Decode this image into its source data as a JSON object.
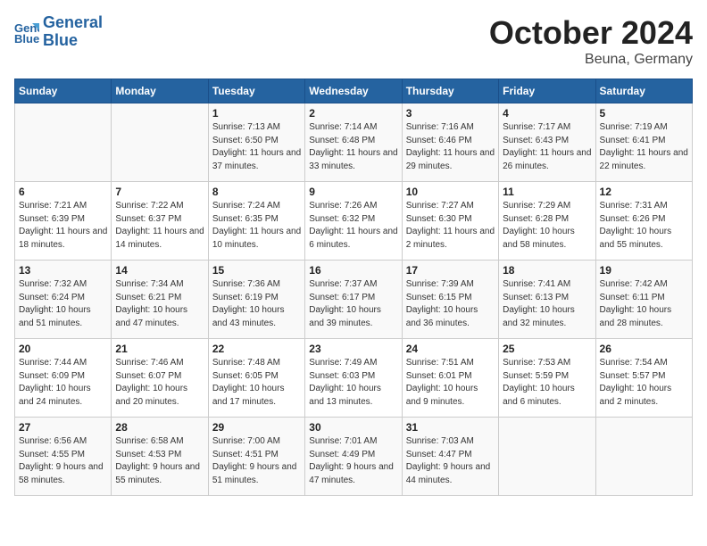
{
  "header": {
    "logo": {
      "line1": "General",
      "line2": "Blue"
    },
    "month": "October 2024",
    "location": "Beuna, Germany"
  },
  "weekdays": [
    "Sunday",
    "Monday",
    "Tuesday",
    "Wednesday",
    "Thursday",
    "Friday",
    "Saturday"
  ],
  "weeks": [
    [
      {
        "day": "",
        "info": ""
      },
      {
        "day": "",
        "info": ""
      },
      {
        "day": "1",
        "info": "Sunrise: 7:13 AM\nSunset: 6:50 PM\nDaylight: 11 hours\nand 37 minutes."
      },
      {
        "day": "2",
        "info": "Sunrise: 7:14 AM\nSunset: 6:48 PM\nDaylight: 11 hours\nand 33 minutes."
      },
      {
        "day": "3",
        "info": "Sunrise: 7:16 AM\nSunset: 6:46 PM\nDaylight: 11 hours\nand 29 minutes."
      },
      {
        "day": "4",
        "info": "Sunrise: 7:17 AM\nSunset: 6:43 PM\nDaylight: 11 hours\nand 26 minutes."
      },
      {
        "day": "5",
        "info": "Sunrise: 7:19 AM\nSunset: 6:41 PM\nDaylight: 11 hours\nand 22 minutes."
      }
    ],
    [
      {
        "day": "6",
        "info": "Sunrise: 7:21 AM\nSunset: 6:39 PM\nDaylight: 11 hours\nand 18 minutes."
      },
      {
        "day": "7",
        "info": "Sunrise: 7:22 AM\nSunset: 6:37 PM\nDaylight: 11 hours\nand 14 minutes."
      },
      {
        "day": "8",
        "info": "Sunrise: 7:24 AM\nSunset: 6:35 PM\nDaylight: 11 hours\nand 10 minutes."
      },
      {
        "day": "9",
        "info": "Sunrise: 7:26 AM\nSunset: 6:32 PM\nDaylight: 11 hours\nand 6 minutes."
      },
      {
        "day": "10",
        "info": "Sunrise: 7:27 AM\nSunset: 6:30 PM\nDaylight: 11 hours\nand 2 minutes."
      },
      {
        "day": "11",
        "info": "Sunrise: 7:29 AM\nSunset: 6:28 PM\nDaylight: 10 hours\nand 58 minutes."
      },
      {
        "day": "12",
        "info": "Sunrise: 7:31 AM\nSunset: 6:26 PM\nDaylight: 10 hours\nand 55 minutes."
      }
    ],
    [
      {
        "day": "13",
        "info": "Sunrise: 7:32 AM\nSunset: 6:24 PM\nDaylight: 10 hours\nand 51 minutes."
      },
      {
        "day": "14",
        "info": "Sunrise: 7:34 AM\nSunset: 6:21 PM\nDaylight: 10 hours\nand 47 minutes."
      },
      {
        "day": "15",
        "info": "Sunrise: 7:36 AM\nSunset: 6:19 PM\nDaylight: 10 hours\nand 43 minutes."
      },
      {
        "day": "16",
        "info": "Sunrise: 7:37 AM\nSunset: 6:17 PM\nDaylight: 10 hours\nand 39 minutes."
      },
      {
        "day": "17",
        "info": "Sunrise: 7:39 AM\nSunset: 6:15 PM\nDaylight: 10 hours\nand 36 minutes."
      },
      {
        "day": "18",
        "info": "Sunrise: 7:41 AM\nSunset: 6:13 PM\nDaylight: 10 hours\nand 32 minutes."
      },
      {
        "day": "19",
        "info": "Sunrise: 7:42 AM\nSunset: 6:11 PM\nDaylight: 10 hours\nand 28 minutes."
      }
    ],
    [
      {
        "day": "20",
        "info": "Sunrise: 7:44 AM\nSunset: 6:09 PM\nDaylight: 10 hours\nand 24 minutes."
      },
      {
        "day": "21",
        "info": "Sunrise: 7:46 AM\nSunset: 6:07 PM\nDaylight: 10 hours\nand 20 minutes."
      },
      {
        "day": "22",
        "info": "Sunrise: 7:48 AM\nSunset: 6:05 PM\nDaylight: 10 hours\nand 17 minutes."
      },
      {
        "day": "23",
        "info": "Sunrise: 7:49 AM\nSunset: 6:03 PM\nDaylight: 10 hours\nand 13 minutes."
      },
      {
        "day": "24",
        "info": "Sunrise: 7:51 AM\nSunset: 6:01 PM\nDaylight: 10 hours\nand 9 minutes."
      },
      {
        "day": "25",
        "info": "Sunrise: 7:53 AM\nSunset: 5:59 PM\nDaylight: 10 hours\nand 6 minutes."
      },
      {
        "day": "26",
        "info": "Sunrise: 7:54 AM\nSunset: 5:57 PM\nDaylight: 10 hours\nand 2 minutes."
      }
    ],
    [
      {
        "day": "27",
        "info": "Sunrise: 6:56 AM\nSunset: 4:55 PM\nDaylight: 9 hours\nand 58 minutes."
      },
      {
        "day": "28",
        "info": "Sunrise: 6:58 AM\nSunset: 4:53 PM\nDaylight: 9 hours\nand 55 minutes."
      },
      {
        "day": "29",
        "info": "Sunrise: 7:00 AM\nSunset: 4:51 PM\nDaylight: 9 hours\nand 51 minutes."
      },
      {
        "day": "30",
        "info": "Sunrise: 7:01 AM\nSunset: 4:49 PM\nDaylight: 9 hours\nand 47 minutes."
      },
      {
        "day": "31",
        "info": "Sunrise: 7:03 AM\nSunset: 4:47 PM\nDaylight: 9 hours\nand 44 minutes."
      },
      {
        "day": "",
        "info": ""
      },
      {
        "day": "",
        "info": ""
      }
    ]
  ]
}
